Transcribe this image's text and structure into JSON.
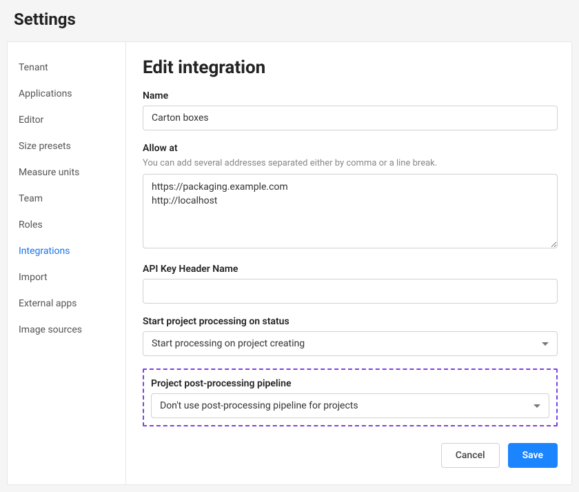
{
  "page": {
    "title": "Settings"
  },
  "sidebar": {
    "items": [
      {
        "label": "Tenant",
        "active": false
      },
      {
        "label": "Applications",
        "active": false
      },
      {
        "label": "Editor",
        "active": false
      },
      {
        "label": "Size presets",
        "active": false
      },
      {
        "label": "Measure units",
        "active": false
      },
      {
        "label": "Team",
        "active": false
      },
      {
        "label": "Roles",
        "active": false
      },
      {
        "label": "Integrations",
        "active": true
      },
      {
        "label": "Import",
        "active": false
      },
      {
        "label": "External apps",
        "active": false
      },
      {
        "label": "Image sources",
        "active": false
      }
    ]
  },
  "main": {
    "title": "Edit integration",
    "form": {
      "name_label": "Name",
      "name_value": "Carton boxes",
      "allow_at_label": "Allow at",
      "allow_at_help": "You can add several addresses separated either by comma or a line break.",
      "allow_at_value": "https://packaging.example.com\nhttp://localhost",
      "api_key_label": "API Key Header Name",
      "api_key_value": "",
      "start_status_label": "Start project processing on status",
      "start_status_value": "Start processing on project creating",
      "post_processing_label": "Project post-processing pipeline",
      "post_processing_value": "Don't use post-processing pipeline for projects"
    },
    "buttons": {
      "cancel_label": "Cancel",
      "save_label": "Save"
    }
  }
}
